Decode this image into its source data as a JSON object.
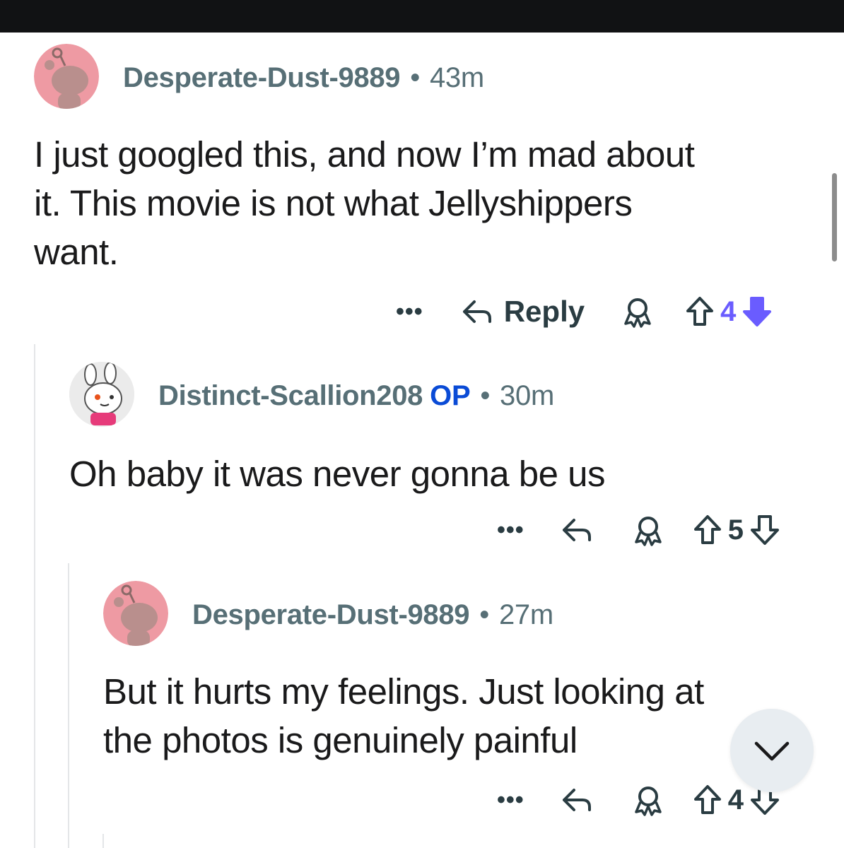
{
  "comments": [
    {
      "username": "Desperate-Dust-9889",
      "op_label": "",
      "age": "43m",
      "body_lines": [
        "I just googled this, and now I’m mad about",
        "it. This movie is not what Jellyshippers",
        "want."
      ],
      "reply_label": "Reply",
      "score": "4",
      "vote_state": "downvoted"
    },
    {
      "username": "Distinct-Scallion208",
      "op_label": "OP",
      "age": "30m",
      "body_lines": [
        "Oh baby it was never gonna be us"
      ],
      "reply_label": "",
      "score": "5",
      "vote_state": "none"
    },
    {
      "username": "Desperate-Dust-9889",
      "op_label": "",
      "age": "27m",
      "body_lines": [
        "But it hurts my feelings. Just looking at",
        "the photos is genuinely painful"
      ],
      "reply_label": "",
      "score": "4",
      "vote_state": "none"
    }
  ],
  "separator": "•",
  "more_label": "•••",
  "icons": {
    "more": "more-options-icon",
    "reply": "reply-arrow-icon",
    "award": "award-icon",
    "upvote": "upvote-arrow-icon",
    "downvote": "downvote-arrow-icon",
    "scroll_down": "chevron-down-icon"
  },
  "colors": {
    "vote_accent": "#6a5cff",
    "op_blue": "#0a4bd6",
    "meta_gray": "#576f76",
    "avatar_pink": "#ee9aa3"
  }
}
